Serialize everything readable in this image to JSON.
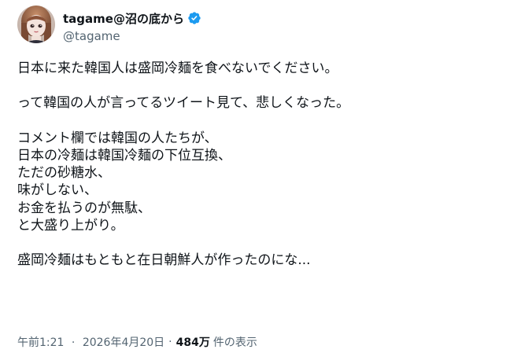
{
  "author": {
    "display_name": "tagame@沼の底から",
    "handle": "@tagame",
    "verified": true,
    "verified_color": "#1d9bf0"
  },
  "tweet": {
    "paragraphs": [
      [
        "日本に来た韓国人は盛岡冷麺を食べないでください。"
      ],
      [
        "って韓国の人が言ってるツイート見て、悲しくなった。"
      ],
      [
        "コメント欄では韓国の人たちが、",
        "日本の冷麺は韓国冷麺の下位互換、",
        "ただの砂糖水、",
        "味がしない、",
        "お金を払うのが無駄、",
        "と大盛り上がり。"
      ],
      [
        "盛岡冷麺はもともと在日朝鮮人が作ったのにな..."
      ]
    ]
  },
  "meta": {
    "time": "午前1:21",
    "date": "2026年4月20日",
    "separator": "·",
    "views_count": "484万",
    "views_label": "件の表示"
  },
  "colors": {
    "text": "#0f1419",
    "secondary": "#536471",
    "accent": "#1d9bf0"
  },
  "icons": {
    "avatar": "doll-portrait-avatar",
    "verified": "verified-badge-icon"
  }
}
